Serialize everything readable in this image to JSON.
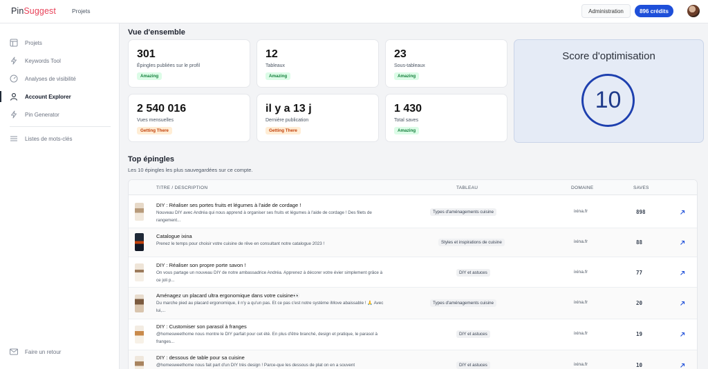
{
  "topbar": {
    "logo_a": "Pin",
    "logo_b": "Suggest",
    "projects_link": "Projets",
    "admin_label": "Administration",
    "credits_label": "896 crédits"
  },
  "sidebar": {
    "items": [
      {
        "label": "Projets",
        "icon": "layout-icon"
      },
      {
        "label": "Keywords Tool",
        "icon": "bolt-icon"
      },
      {
        "label": "Analyses de visibilité",
        "icon": "gauge-icon"
      },
      {
        "label": "Account Explorer",
        "icon": "user-icon",
        "active": true
      },
      {
        "label": "Pin Generator",
        "icon": "bolt-icon"
      },
      {
        "label": "Listes de mots-clés",
        "icon": "list-icon"
      }
    ],
    "feedback_label": "Faire un retour"
  },
  "overview": {
    "title": "Vue d'ensemble",
    "stats": [
      {
        "value": "301",
        "label": "Épingles publiées sur le profil",
        "badge": "Amazing",
        "badge_type": "good"
      },
      {
        "value": "12",
        "label": "Tableaux",
        "badge": "Amazing",
        "badge_type": "good"
      },
      {
        "value": "23",
        "label": "Sous-tableaux",
        "badge": "Amazing",
        "badge_type": "good"
      },
      {
        "value": "2 540 016",
        "label": "Vues mensuelles",
        "badge": "Getting There",
        "badge_type": "mid"
      },
      {
        "value": "il y a 13 j",
        "label": "Dernière publication",
        "badge": "Getting There",
        "badge_type": "mid"
      },
      {
        "value": "1 430",
        "label": "Total saves",
        "badge": "Amazing",
        "badge_type": "good"
      }
    ],
    "score_title": "Score d'optimisation",
    "score_value": "10"
  },
  "top_pins": {
    "title": "Top épingles",
    "subtitle": "Les 10 épingles les plus sauvegardées sur ce compte.",
    "columns": {
      "title": "TITRE / DESCRIPTION",
      "board": "TABLEAU",
      "domain": "DOMAINE",
      "saves": "SAVES"
    },
    "rows": [
      {
        "title": "DIY : Réaliser ses portes fruits et légumes à l'aide de cordage !",
        "desc": "Nouveau DIY avec Andréa qui nous apprend à organiser ses fruits et légumes à l'aide de cordage ! Des filets de rangement...",
        "board": "Types d'aménagements cuisine",
        "domain": "ixina.fr",
        "saves": "898"
      },
      {
        "title": "Catalogue ixina",
        "desc": "Prenez le temps pour choisir votre cuisine de rêve en consultant notre catalogue 2023 !",
        "board": "Styles et inspirations de cuisine",
        "domain": "ixina.fr",
        "saves": "88"
      },
      {
        "title": "DIY : Réaliser son propre porte savon !",
        "desc": "On vous partage un nouveau DIY de notre ambassadrice Andréa. Apprenez à décorer votre évier simplement grâce à ce joli p...",
        "board": "DIY et astuces",
        "domain": "ixina.fr",
        "saves": "77"
      },
      {
        "title": "Aménagez un placard ultra ergonomique dans votre cuisine👀",
        "desc": "Du marche pied au placard ergonomique, il n'y a qu'un pas. Et ce pas c'est notre système iMove abaissable ! 🙏 Avec lui,...",
        "board": "Types d'aménagements cuisine",
        "domain": "ixina.fr",
        "saves": "20"
      },
      {
        "title": "DIY : Customiser son parasol à franges",
        "desc": "@homesweethome nous montre le DIY parfait pour cet été. En plus d'être branché, design et pratique, le parasol à franges...",
        "board": "DIY et astuces",
        "domain": "ixina.fr",
        "saves": "19"
      },
      {
        "title": "DIY : dessous de table pour sa cuisine",
        "desc": "@homesweethome nous fait part d'un DIY très design ! Parce-que les dessous de plat on en a souvent",
        "board": "DIY et astuces",
        "domain": "ixina.fr",
        "saves": "10"
      }
    ]
  },
  "colors": {
    "accent": "#1e4fd9",
    "brand": "#e8435a",
    "good": "#15803d",
    "mid": "#c2410c"
  }
}
